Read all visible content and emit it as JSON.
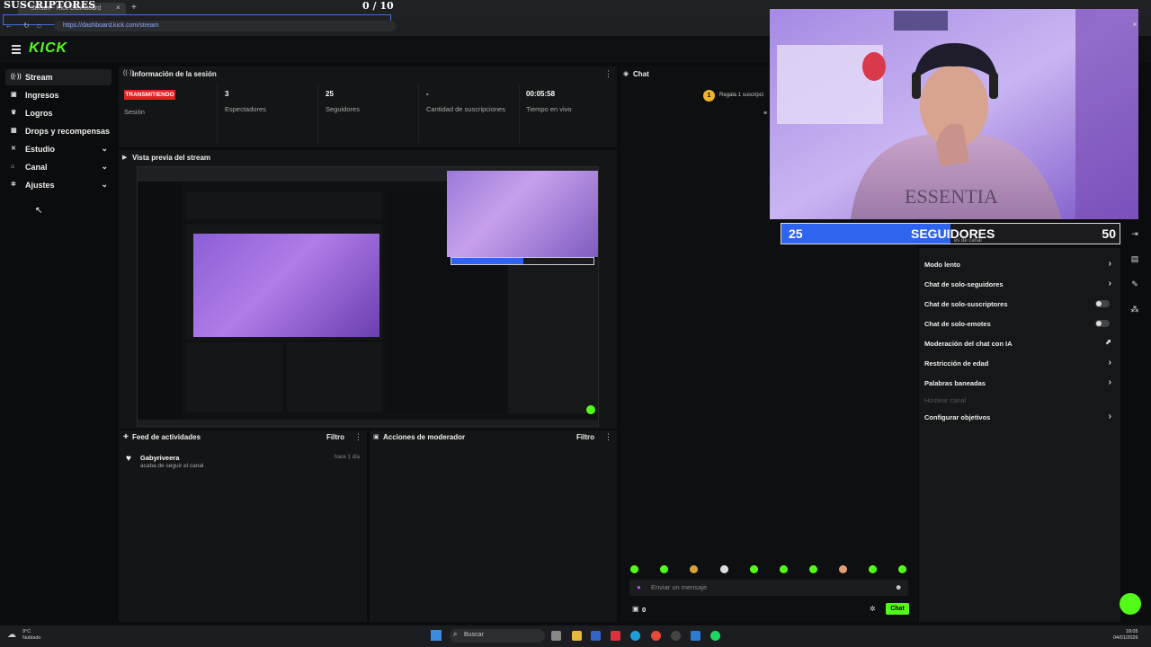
{
  "overlay": {
    "title": "SUSCRIPTORES",
    "counter": "0  / 10"
  },
  "browser": {
    "tab_label": "Stream - Kick Dashboard",
    "url": "https://dashboard.kick.com/stream"
  },
  "app": {
    "logo": "KICK"
  },
  "sidebar": {
    "items": [
      {
        "label": "Stream",
        "icon": "broadcast-icon"
      },
      {
        "label": "Ingresos",
        "icon": "money-icon"
      },
      {
        "label": "Logros",
        "icon": "trophy-icon"
      },
      {
        "label": "Drops y recompensas",
        "icon": "gift-icon"
      },
      {
        "label": "Estudio",
        "icon": "studio-icon"
      },
      {
        "label": "Canal",
        "icon": "channel-icon"
      },
      {
        "label": "Ajustes",
        "icon": "gear-icon"
      }
    ]
  },
  "session": {
    "title": "Información de la sesión",
    "status_badge": "TRANSMITIENDO",
    "status_label": "Sesión",
    "viewers": "3",
    "viewers_label": "Espectadores",
    "followers": "25",
    "followers_label": "Seguidores",
    "subs": "-",
    "subs_label": "Cantidad de suscripciones",
    "live_time": "00:05:58",
    "live_time_label": "Tiempo en vivo"
  },
  "preview": {
    "title": "Vista previa del stream"
  },
  "activity": {
    "title": "Feed de actividades",
    "filter": "Filtro",
    "user": "Gabyriveera",
    "action": "acaba de seguir el canal",
    "time": "hace 1 día"
  },
  "moderator": {
    "title": "Acciones de moderador",
    "filter": "Filtro"
  },
  "chat": {
    "title": "Chat",
    "gift_text": "Regala 1 suscripci",
    "input_placeholder": "Enviar un mensaje",
    "send_label": "Chat",
    "points": "0"
  },
  "follow_goal": {
    "current": "25",
    "label": "SEGUIDORES",
    "goal": "50",
    "subtitle": "es de canal",
    "progress": 0.5
  },
  "chat_settings": {
    "items": [
      {
        "label": "Modo lento",
        "control": "arrow"
      },
      {
        "label": "Chat de solo-seguidores",
        "control": "arrow"
      },
      {
        "label": "Chat de solo-suscriptores",
        "control": "toggle"
      },
      {
        "label": "Chat de solo-emotes",
        "control": "toggle"
      },
      {
        "label": "Moderación del chat con IA",
        "control": "chart"
      },
      {
        "label": "Restricción de edad",
        "control": "arrow"
      },
      {
        "label": "Palabras baneadas",
        "control": "arrow"
      },
      {
        "label": "Hostear canal",
        "control": "none",
        "muted": true
      },
      {
        "label": "Configurar objetivos",
        "control": "arrow"
      }
    ]
  },
  "taskbar": {
    "search": "Buscar",
    "time": "18:05",
    "date": "04/01/2026",
    "weather_temp": "9°C",
    "weather_text": "Nublado"
  },
  "colors": {
    "brand": "#53fc18",
    "live": "#e02020",
    "follow_fill": "#2f64f1"
  }
}
